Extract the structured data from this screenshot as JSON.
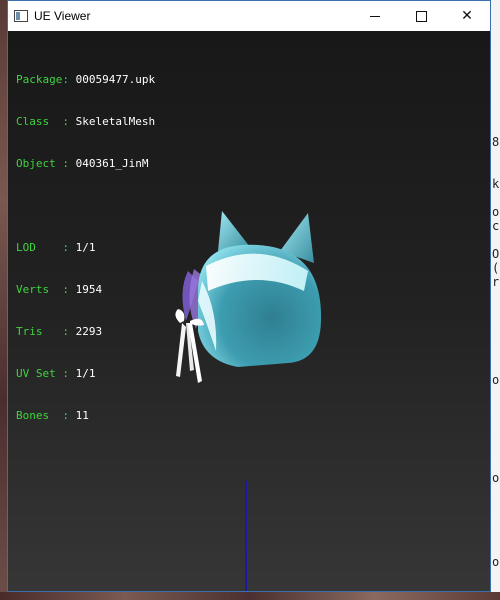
{
  "window": {
    "title": "UE Viewer",
    "controls": {
      "minimize": "",
      "maximize": "",
      "close": "✕"
    }
  },
  "info": {
    "package_label": "Package: ",
    "package": "00059477.upk",
    "class_label": "Class  : ",
    "class": "SkeletalMesh",
    "object_label": "Object : ",
    "object": "040361_JinM",
    "lod_label": "LOD    : ",
    "lod": "1/1",
    "verts_label": "Verts  : ",
    "verts": "1954",
    "tris_label": "Tris   : ",
    "tris": "2293",
    "uvset_label": "UV Set : ",
    "uvset": "1/1",
    "bones_label": "Bones  : ",
    "bones": "11"
  },
  "background_glyphs": [
    "8",
    "k",
    "o",
    "c",
    "O",
    "(",
    "r",
    "o",
    "o",
    "o"
  ],
  "colors": {
    "label": "#3fd43f",
    "value": "#ffffff",
    "mesh": "#4fb4c8",
    "axis": "#1a1aa8"
  }
}
